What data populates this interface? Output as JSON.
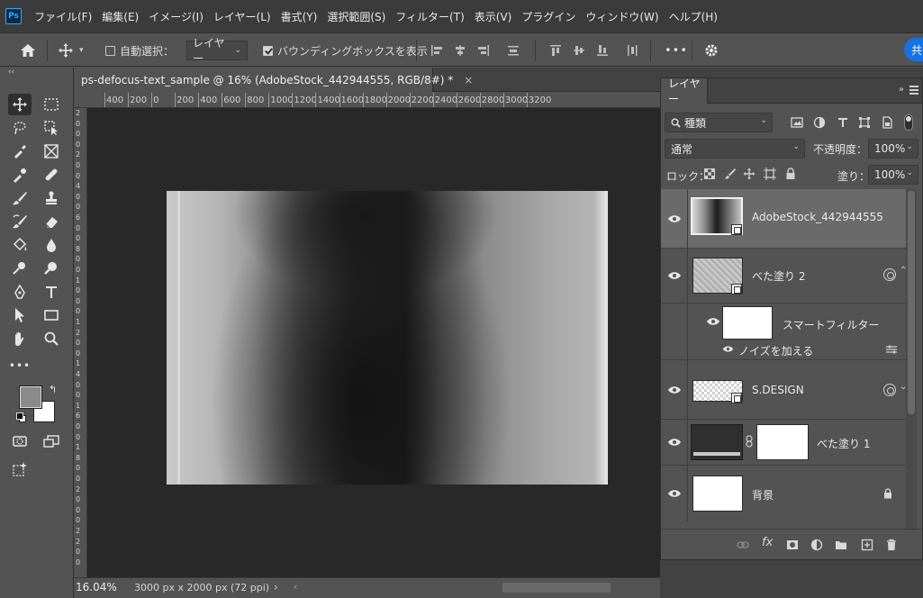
{
  "app": {
    "logo": "Ps"
  },
  "menu": [
    "ファイル(F)",
    "編集(E)",
    "イメージ(I)",
    "レイヤー(L)",
    "書式(Y)",
    "選択範囲(S)",
    "フィルター(T)",
    "表示(V)",
    "プラグイン",
    "ウィンドウ(W)",
    "ヘルプ(H)"
  ],
  "options": {
    "auto_select_label": "自動選択：",
    "auto_select_target": "レイヤー",
    "bounding_box_label": "バウンディングボックスを表示",
    "more_label": "•••",
    "share_label": "共"
  },
  "document": {
    "tab_title": "ps-defocus-text_sample @ 16% (AdobeStock_442944555, RGB/8#) *",
    "close_glyph": "×"
  },
  "ruler": {
    "h_labels": [
      "400",
      "200",
      "0",
      "200",
      "400",
      "600",
      "800",
      "1000",
      "1200",
      "1400",
      "1600",
      "1800",
      "2000",
      "2200",
      "2400",
      "2600",
      "2800",
      "3000",
      "3200"
    ],
    "v_labels": [
      "2",
      "0",
      "0",
      "0",
      "2",
      "0",
      "0",
      "4",
      "0",
      "0",
      "6",
      "0",
      "0",
      "8",
      "0",
      "0",
      "1",
      "0",
      "0",
      "0",
      "1",
      "2",
      "0",
      "0",
      "1",
      "4",
      "0",
      "0",
      "1",
      "6",
      "0",
      "0",
      "1",
      "8",
      "0",
      "0",
      "2",
      "0",
      "0",
      "0",
      "2",
      "2",
      "0",
      "0"
    ]
  },
  "status": {
    "zoom": "16.04%",
    "doc_info": "3000 px x 2000 px (72 ppi)",
    "arrow": "›",
    "scroll_left": "‹"
  },
  "layers_panel": {
    "tab_label": "レイヤー",
    "collapse_glyph": "»",
    "filter_kind": "種類",
    "blend_mode": "通常",
    "opacity_label": "不透明度：",
    "opacity_value": "100%",
    "lock_label": "ロック：",
    "fill_label": "塗り：",
    "fill_value": "100%",
    "layers": [
      {
        "name": "AdobeStock_442944555",
        "selected": true
      },
      {
        "name": "べた塗り 2"
      },
      {
        "name": "スマートフィルター"
      },
      {
        "name": "ノイズを加える"
      },
      {
        "name": "S.DESIGN"
      },
      {
        "name": "べた塗り 1"
      },
      {
        "name": "背景"
      }
    ],
    "footer_fx": "fx"
  },
  "colors": {
    "foreground": "#8a8a8a",
    "background": "#ffffff",
    "accent": "#1473e6"
  }
}
